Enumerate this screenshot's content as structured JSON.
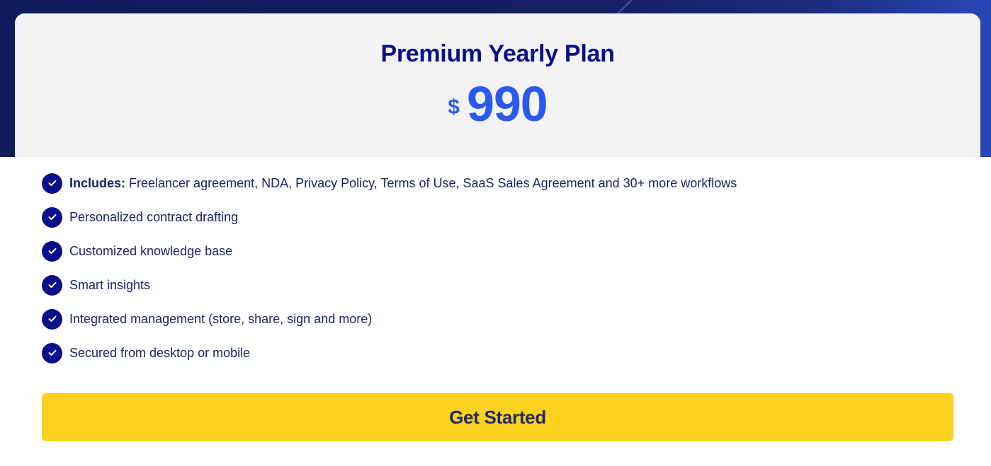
{
  "plan": {
    "title": "Premium Yearly Plan",
    "currency": "$",
    "price": "990"
  },
  "features": {
    "includes_label": "Includes:",
    "includes_text": " Freelancer agreement, NDA, Privacy Policy, Terms of Use, SaaS Sales Agreement and 30+ more workflows",
    "items": [
      "Personalized contract drafting",
      "Customized knowledge base",
      "Smart insights",
      "Integrated management (store, share, sign and more)",
      "Secured from desktop or mobile"
    ],
    "icon": "check-circle-icon"
  },
  "cta": {
    "label": "Get Started"
  },
  "colors": {
    "title": "#0c0f8a",
    "price": "#2b59f0",
    "button_bg": "#fcd11f",
    "check_bg": "#0c0f8a",
    "header_bg": "#f3f3f6",
    "backdrop": "#141f62"
  }
}
